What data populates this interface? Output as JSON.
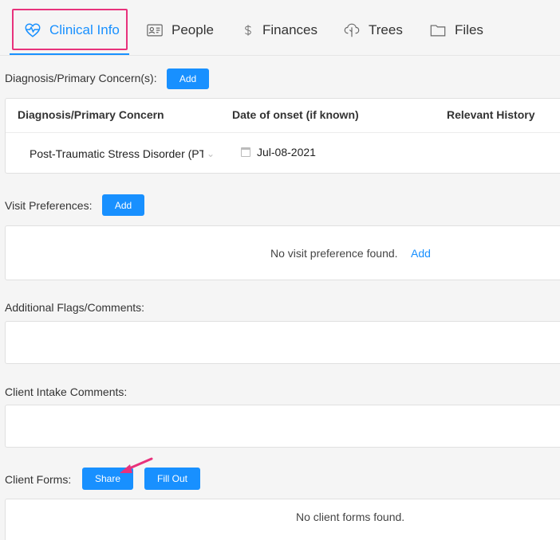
{
  "tabs": [
    {
      "label": "Clinical Info",
      "icon": "heartbeat-icon",
      "active": true
    },
    {
      "label": "People",
      "icon": "id-card-icon",
      "active": false
    },
    {
      "label": "Finances",
      "icon": "dollar-icon",
      "active": false
    },
    {
      "label": "Trees",
      "icon": "tree-icon",
      "active": false
    },
    {
      "label": "Files",
      "icon": "folder-icon",
      "active": false
    }
  ],
  "diagnosis": {
    "label": "Diagnosis/Primary Concern(s):",
    "add_label": "Add",
    "columns": [
      "Diagnosis/Primary Concern",
      "Date of onset (if known)",
      "Relevant History"
    ],
    "rows": [
      {
        "concern": "Post-Traumatic Stress Disorder (PTSD)",
        "onset": "Jul-08-2021",
        "history": ""
      }
    ]
  },
  "visit_preferences": {
    "label": "Visit Preferences:",
    "add_label": "Add",
    "empty_text": "No visit preference found.",
    "empty_link": "Add"
  },
  "additional_flags": {
    "label": "Additional Flags/Comments:",
    "value": ""
  },
  "intake_comments": {
    "label": "Client Intake Comments:",
    "value": ""
  },
  "client_forms": {
    "label": "Client Forms:",
    "share_label": "Share",
    "fill_out_label": "Fill Out",
    "empty_text": "No client forms found."
  },
  "colors": {
    "accent": "#1890ff",
    "highlight": "#e8327c",
    "background": "#f5f5f5"
  }
}
